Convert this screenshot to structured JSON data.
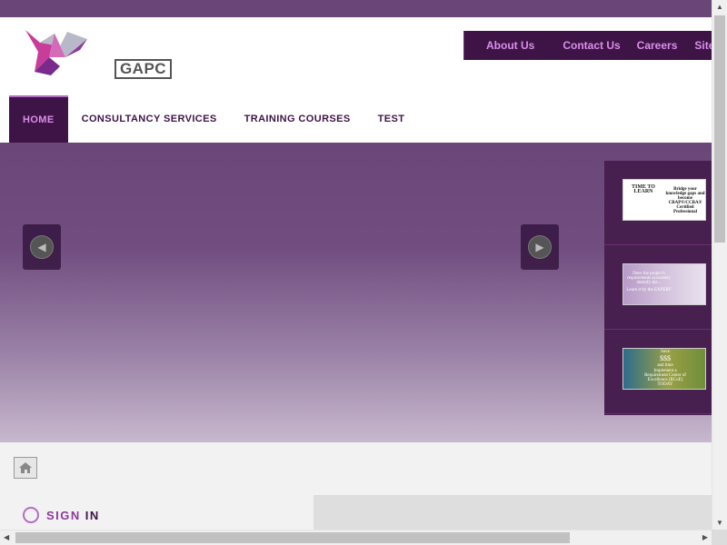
{
  "logo": {
    "text": "GAPC"
  },
  "top_links": [
    "About Us",
    "Contact Us",
    "Careers",
    "Site"
  ],
  "nav": {
    "items": [
      "HOME",
      "CONSULTANCY SERVICES",
      "TRAINING COURSES",
      "TEST"
    ],
    "active_index": 0
  },
  "slider": {
    "thumbnails": [
      {
        "lines": [
          "TIME TO LEARN",
          "Bridge your knowledge gaps and become CBAP®/CCBA® Certified Professional"
        ]
      },
      {
        "lines": [
          "Does the project's requirements accurately identify the...",
          "Learn it by the EXPERT"
        ]
      },
      {
        "lines": [
          "Save",
          "$$$",
          "and time",
          "Implement a Requirement Center of Excellence (RCoE) TODAY"
        ]
      }
    ]
  },
  "signin": {
    "word1": "SIGN",
    "word2": "IN"
  },
  "colors": {
    "brand_dark": "#3e1447",
    "brand_accent": "#d98fe8",
    "topbar": "#6a4678"
  },
  "icons": [
    "home-icon",
    "arrow-left-icon",
    "arrow-right-icon",
    "ring-icon"
  ]
}
